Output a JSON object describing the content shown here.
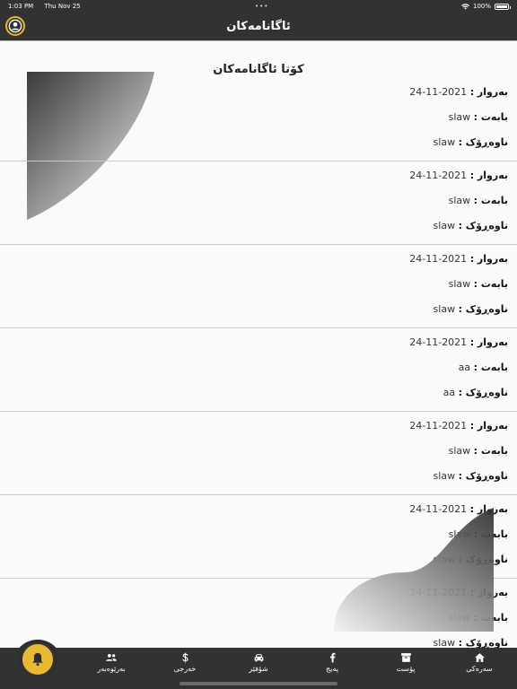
{
  "status_bar": {
    "time": "1:03 PM",
    "date": "Thu Nov 25",
    "battery": "100%"
  },
  "header": {
    "title": "ئاگانامەکان"
  },
  "main": {
    "section_title": "کۆتا ئاگانامەکان",
    "labels": {
      "date": "بەروار :",
      "subject": "بابەت :",
      "content": "ناوەڕۆک :"
    },
    "notifications": [
      {
        "date": "2021-11-24",
        "subject": "slaw",
        "content": "slaw"
      },
      {
        "date": "2021-11-24",
        "subject": "slaw",
        "content": "slaw"
      },
      {
        "date": "2021-11-24",
        "subject": "slaw",
        "content": "slaw"
      },
      {
        "date": "2021-11-24",
        "subject": "aa",
        "content": "aa"
      },
      {
        "date": "2021-11-24",
        "subject": "slaw",
        "content": "slaw"
      },
      {
        "date": "2021-11-24",
        "subject": "slaw",
        "content": "slaw"
      },
      {
        "date": "2021-11-24",
        "subject": "slaw",
        "content": "slaw"
      }
    ]
  },
  "bottom_nav": {
    "items": [
      {
        "label": "سەرەکی",
        "icon": "home-icon"
      },
      {
        "label": "پۆست",
        "icon": "archive-icon"
      },
      {
        "label": "پەیج",
        "icon": "facebook-icon"
      },
      {
        "label": "شۆفێر",
        "icon": "car-icon"
      },
      {
        "label": "خەرجی",
        "icon": "dollar-icon"
      },
      {
        "label": "بەرێوەبەر",
        "icon": "users-icon"
      }
    ],
    "fab_icon": "bell-icon"
  },
  "colors": {
    "bar": "#323232",
    "accent": "#e8b934",
    "background": "#fafafa",
    "divider": "#c9c9c9"
  }
}
